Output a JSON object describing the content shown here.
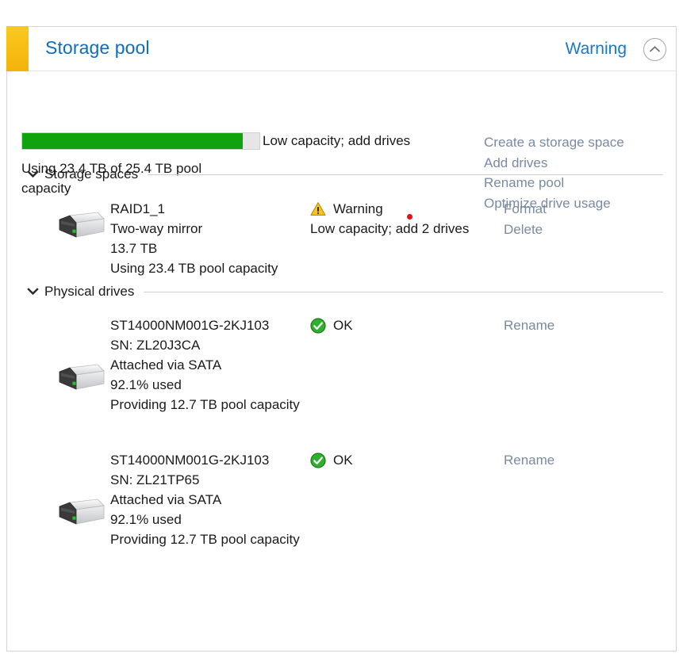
{
  "header": {
    "title": "Storage pool",
    "status": "Warning",
    "collapse_icon": "chevron-up-icon",
    "accent_color": "#f7bd12",
    "title_color": "#0f6cbd",
    "status_color": "#1478d4"
  },
  "pool": {
    "bar_percent": 93,
    "bar_fill_color": "#10a310",
    "bar_caption": "Low capacity; add drives",
    "usage_text": "Using 23.4 TB of 25.4 TB pool capacity",
    "actions": [
      {
        "label": "Create a storage space"
      },
      {
        "label": "Add drives"
      },
      {
        "label": "Rename pool"
      },
      {
        "label": "Optimize drive usage"
      }
    ]
  },
  "marker": {
    "name": "red-dot",
    "color": "#e81010"
  },
  "sections": [
    {
      "label": "Storage spaces",
      "chevron": "chevron-down-icon",
      "items": [
        {
          "icon": "hard-drive-icon",
          "name": "RAID1_1",
          "line2": "Two-way mirror",
          "line3": "13.7 TB",
          "line4": "Using 23.4 TB pool capacity",
          "status_icon": "warning-triangle-icon",
          "status_label": "Warning",
          "status_detail": "Low capacity; add 2 drives",
          "links": [
            {
              "label": "Format"
            },
            {
              "label": "Delete"
            }
          ]
        }
      ]
    },
    {
      "label": "Physical drives",
      "chevron": "chevron-down-icon",
      "items": [
        {
          "icon": "hard-drive-icon",
          "name": "ST14000NM001G-2KJ103",
          "line2": "SN: ZL20J3CA",
          "line3": "Attached via SATA",
          "line4": "92.1% used",
          "line5": "Providing 12.7 TB pool capacity",
          "status_icon": "ok-check-icon",
          "status_label": "OK",
          "links": [
            {
              "label": "Rename"
            }
          ]
        },
        {
          "icon": "hard-drive-icon",
          "name": "ST14000NM001G-2KJ103",
          "line2": "SN: ZL21TP65",
          "line3": "Attached via SATA",
          "line4": "92.1% used",
          "line5": "Providing 12.7 TB pool capacity",
          "status_icon": "ok-check-icon",
          "status_label": "OK",
          "links": [
            {
              "label": "Rename"
            }
          ]
        }
      ]
    }
  ]
}
